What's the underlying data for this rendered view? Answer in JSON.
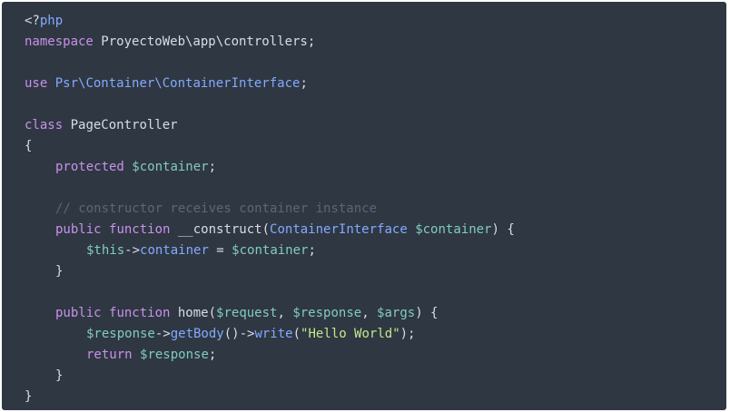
{
  "code_lines": [
    {
      "indent": 0,
      "tokens": [
        {
          "text": "<?",
          "kind": "plain"
        },
        {
          "text": "php",
          "kind": "type"
        }
      ]
    },
    {
      "indent": 0,
      "tokens": [
        {
          "text": "namespace",
          "kind": "keyword"
        },
        {
          "text": " ProyectoWeb\\app\\controllers;",
          "kind": "plain"
        }
      ]
    },
    {
      "indent": 0,
      "tokens": []
    },
    {
      "indent": 0,
      "tokens": [
        {
          "text": "use",
          "kind": "keyword"
        },
        {
          "text": " ",
          "kind": "plain"
        },
        {
          "text": "Psr\\Container\\ContainerInterface",
          "kind": "type"
        },
        {
          "text": ";",
          "kind": "plain"
        }
      ]
    },
    {
      "indent": 0,
      "tokens": []
    },
    {
      "indent": 0,
      "tokens": [
        {
          "text": "class",
          "kind": "keyword"
        },
        {
          "text": " PageController",
          "kind": "plain"
        }
      ]
    },
    {
      "indent": 0,
      "tokens": [
        {
          "text": "{",
          "kind": "plain"
        }
      ]
    },
    {
      "indent": 1,
      "tokens": [
        {
          "text": "protected",
          "kind": "keyword"
        },
        {
          "text": " ",
          "kind": "plain"
        },
        {
          "text": "$container",
          "kind": "var"
        },
        {
          "text": ";",
          "kind": "plain"
        }
      ]
    },
    {
      "indent": 0,
      "tokens": []
    },
    {
      "indent": 1,
      "tokens": [
        {
          "text": "// constructor receives container instance",
          "kind": "comment"
        }
      ]
    },
    {
      "indent": 1,
      "tokens": [
        {
          "text": "public",
          "kind": "keyword"
        },
        {
          "text": " ",
          "kind": "plain"
        },
        {
          "text": "function",
          "kind": "keyword"
        },
        {
          "text": " __construct(",
          "kind": "plain"
        },
        {
          "text": "ContainerInterface",
          "kind": "type"
        },
        {
          "text": " ",
          "kind": "plain"
        },
        {
          "text": "$container",
          "kind": "var"
        },
        {
          "text": ") {",
          "kind": "plain"
        }
      ]
    },
    {
      "indent": 2,
      "tokens": [
        {
          "text": "$this",
          "kind": "var"
        },
        {
          "text": "->",
          "kind": "plain"
        },
        {
          "text": "container",
          "kind": "type"
        },
        {
          "text": " = ",
          "kind": "plain"
        },
        {
          "text": "$container",
          "kind": "var"
        },
        {
          "text": ";",
          "kind": "plain"
        }
      ]
    },
    {
      "indent": 1,
      "tokens": [
        {
          "text": "}",
          "kind": "plain"
        }
      ]
    },
    {
      "indent": 0,
      "tokens": []
    },
    {
      "indent": 1,
      "tokens": [
        {
          "text": "public",
          "kind": "keyword"
        },
        {
          "text": " ",
          "kind": "plain"
        },
        {
          "text": "function",
          "kind": "keyword"
        },
        {
          "text": " home(",
          "kind": "plain"
        },
        {
          "text": "$request",
          "kind": "var"
        },
        {
          "text": ", ",
          "kind": "plain"
        },
        {
          "text": "$response",
          "kind": "var"
        },
        {
          "text": ", ",
          "kind": "plain"
        },
        {
          "text": "$args",
          "kind": "var"
        },
        {
          "text": ") {",
          "kind": "plain"
        }
      ]
    },
    {
      "indent": 2,
      "tokens": [
        {
          "text": "$response",
          "kind": "var"
        },
        {
          "text": "->",
          "kind": "plain"
        },
        {
          "text": "getBody",
          "kind": "type"
        },
        {
          "text": "()->",
          "kind": "plain"
        },
        {
          "text": "write",
          "kind": "type"
        },
        {
          "text": "(",
          "kind": "plain"
        },
        {
          "text": "\"Hello World\"",
          "kind": "string"
        },
        {
          "text": ");",
          "kind": "plain"
        }
      ]
    },
    {
      "indent": 2,
      "tokens": [
        {
          "text": "return",
          "kind": "keyword"
        },
        {
          "text": " ",
          "kind": "plain"
        },
        {
          "text": "$response",
          "kind": "var"
        },
        {
          "text": ";",
          "kind": "plain"
        }
      ]
    },
    {
      "indent": 1,
      "tokens": [
        {
          "text": "}",
          "kind": "plain"
        }
      ]
    },
    {
      "indent": 0,
      "tokens": [
        {
          "text": "}",
          "kind": "plain"
        }
      ]
    }
  ],
  "colors": {
    "background": "#2f3742",
    "plain": "#d7dde8",
    "keyword": "#c792ea",
    "type": "#82aaff",
    "var": "#80cbc4",
    "string": "#c3e88d",
    "comment": "#5c6775"
  }
}
